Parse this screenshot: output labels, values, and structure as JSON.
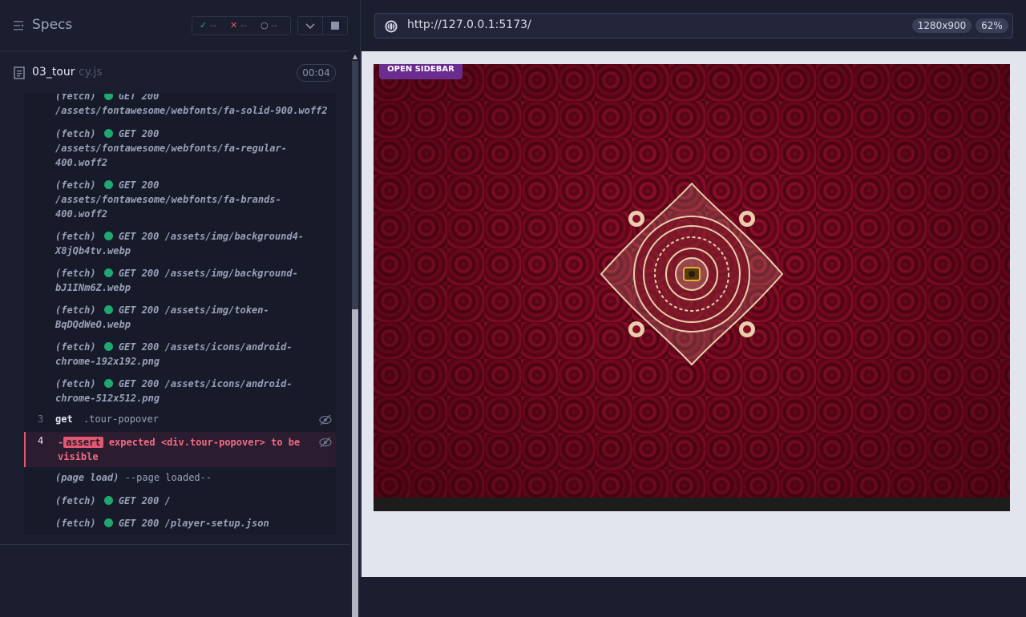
{
  "sidebar": {
    "title": "Specs",
    "stats": {
      "passed": "--",
      "failed": "--",
      "pending": "--"
    },
    "spec": {
      "name": "03_tour",
      "ext": "cy.js",
      "duration": "00:04"
    },
    "log": [
      {
        "kind": "(fetch)",
        "status": "GET 200",
        "url": "/assets/fontawesome/webfonts/fa-solid-900.woff2"
      },
      {
        "kind": "(fetch)",
        "status": "GET 200",
        "url": "/assets/fontawesome/webfonts/fa-regular-400.woff2"
      },
      {
        "kind": "(fetch)",
        "status": "GET 200",
        "url": "/assets/fontawesome/webfonts/fa-brands-400.woff2"
      },
      {
        "kind": "(fetch)",
        "status": "GET 200",
        "url": "/assets/img/background4-X8jQb4tv.webp"
      },
      {
        "kind": "(fetch)",
        "status": "GET 200",
        "url": "/assets/img/background-bJ1INm6Z.webp"
      },
      {
        "kind": "(fetch)",
        "status": "GET 200",
        "url": "/assets/img/token-BqDQdWeO.webp"
      },
      {
        "kind": "(fetch)",
        "status": "GET 200",
        "url": "/assets/icons/android-chrome-192x192.png"
      },
      {
        "kind": "(fetch)",
        "status": "GET 200",
        "url": "/assets/icons/android-chrome-512x512.png"
      }
    ],
    "step3": {
      "num": "3",
      "command": "get",
      "selector": ".tour-popover"
    },
    "step4": {
      "num": "4",
      "prefix": "-",
      "badge": "assert",
      "message": "expected <div.tour-popover> to be visible"
    },
    "after": [
      {
        "kind": "(page load)",
        "text": "--page loaded--"
      },
      {
        "kind": "(fetch)",
        "status": "GET 200",
        "url": "/"
      },
      {
        "kind": "(fetch)",
        "status": "GET 200",
        "url": "/player-setup.json"
      }
    ]
  },
  "browser": {
    "url": "http://127.0.0.1:5173/",
    "viewport": "1280x900",
    "zoom": "62%"
  },
  "app": {
    "open_sidebar": "OPEN SIDEBAR"
  },
  "colors": {
    "pass": "#1fa971",
    "fail": "#e45770",
    "accent": "#6a2c8f"
  }
}
